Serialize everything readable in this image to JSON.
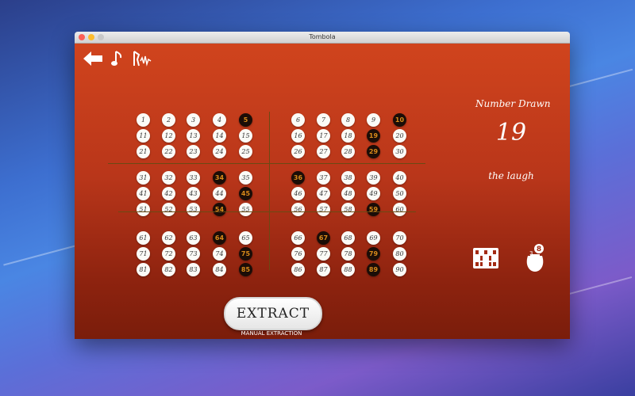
{
  "window": {
    "title": "Tombola"
  },
  "toolbar": {
    "back_icon": "arrow-left-icon",
    "music_icon": "music-note-icon",
    "voice_icon": "voice-icon"
  },
  "board": {
    "drawn": [
      5,
      10,
      19,
      29,
      34,
      36,
      45,
      54,
      59,
      64,
      67,
      75,
      79,
      85,
      89
    ]
  },
  "side": {
    "title": "Number Drawn",
    "number": "19",
    "meaning": "the laugh"
  },
  "buttons": {
    "extract": "EXTRACT",
    "manual": "MANUAL EXTRACTION"
  },
  "colors": {
    "drawn_ball": "#1b0d07",
    "drawn_text": "#d98a1a",
    "board_bg": "#c13c1b"
  }
}
